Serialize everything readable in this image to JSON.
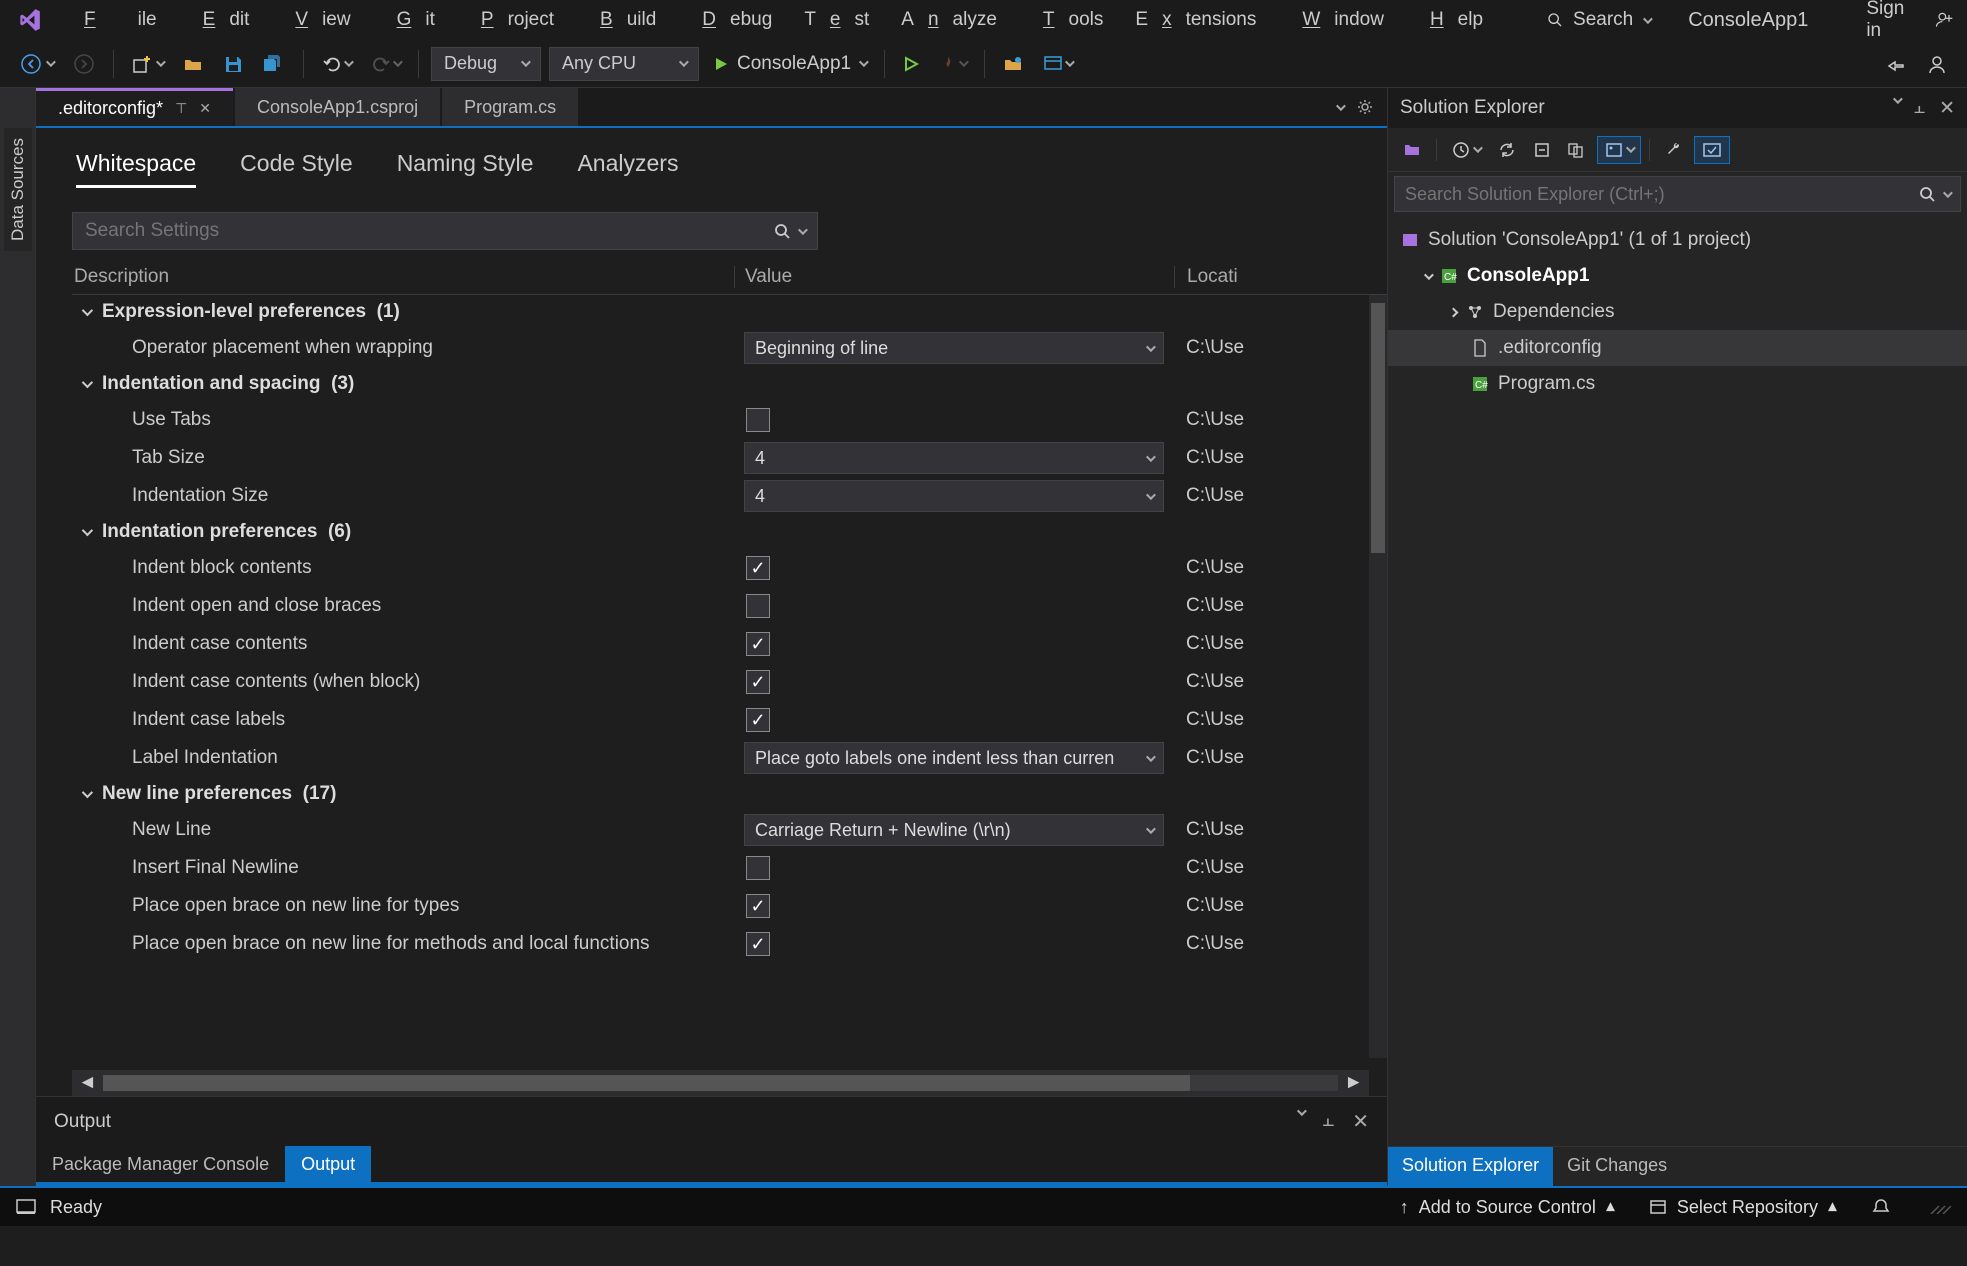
{
  "menu": {
    "file": "File",
    "edit": "Edit",
    "view": "View",
    "git": "Git",
    "project": "Project",
    "build": "Build",
    "debug": "Debug",
    "test": "Test",
    "analyze": "Analyze",
    "tools": "Tools",
    "extensions": "Extensions",
    "window": "Window",
    "help": "Help"
  },
  "titlebar": {
    "search": "Search",
    "app_title": "ConsoleApp1",
    "signin": "Sign in"
  },
  "toolbar": {
    "config": "Debug",
    "platform": "Any CPU",
    "start_target": "ConsoleApp1"
  },
  "left_rail": "Data Sources",
  "tabs": {
    "t1": ".editorconfig*",
    "t2": "ConsoleApp1.csproj",
    "t3": "Program.cs"
  },
  "ec": {
    "tabs": {
      "whitespace": "Whitespace",
      "codestyle": "Code Style",
      "naming": "Naming Style",
      "analyzers": "Analyzers"
    },
    "search_placeholder": "Search Settings",
    "cols": {
      "desc": "Description",
      "val": "Value",
      "loc": "Locati"
    },
    "loc_trunc": "C:\\Use",
    "groups": {
      "g1": {
        "title": "Expression-level preferences",
        "count": "(1)",
        "rows": [
          {
            "d": "Operator placement when wrapping",
            "v": {
              "type": "drop",
              "text": "Beginning of line"
            }
          }
        ]
      },
      "g2": {
        "title": "Indentation and spacing",
        "count": "(3)",
        "rows": [
          {
            "d": "Use Tabs",
            "v": {
              "type": "chk",
              "checked": false
            }
          },
          {
            "d": "Tab Size",
            "v": {
              "type": "drop",
              "text": "4"
            }
          },
          {
            "d": "Indentation Size",
            "v": {
              "type": "drop",
              "text": "4"
            }
          }
        ]
      },
      "g3": {
        "title": "Indentation preferences",
        "count": "(6)",
        "rows": [
          {
            "d": "Indent block contents",
            "v": {
              "type": "chk",
              "checked": true
            }
          },
          {
            "d": "Indent open and close braces",
            "v": {
              "type": "chk",
              "checked": false
            }
          },
          {
            "d": "Indent case contents",
            "v": {
              "type": "chk",
              "checked": true
            }
          },
          {
            "d": "Indent case contents (when block)",
            "v": {
              "type": "chk",
              "checked": true
            }
          },
          {
            "d": "Indent case labels",
            "v": {
              "type": "chk",
              "checked": true
            }
          },
          {
            "d": "Label Indentation",
            "v": {
              "type": "drop",
              "text": "Place goto labels one indent less than curren"
            }
          }
        ]
      },
      "g4": {
        "title": "New line preferences",
        "count": "(17)",
        "rows": [
          {
            "d": "New Line",
            "v": {
              "type": "drop",
              "text": "Carriage Return + Newline (\\r\\n)"
            }
          },
          {
            "d": "Insert Final Newline",
            "v": {
              "type": "chk",
              "checked": false
            }
          },
          {
            "d": "Place open brace on new line for types",
            "v": {
              "type": "chk",
              "checked": true
            }
          },
          {
            "d": "Place open brace on new line for methods and local functions",
            "v": {
              "type": "chk",
              "checked": true
            }
          }
        ]
      }
    }
  },
  "output_title": "Output",
  "bottom_tabs": {
    "pmc": "Package Manager Console",
    "output": "Output"
  },
  "solution": {
    "title": "Solution Explorer",
    "search_placeholder": "Search Solution Explorer (Ctrl+;)",
    "root": "Solution 'ConsoleApp1' (1 of 1 project)",
    "project": "ConsoleApp1",
    "dependencies": "Dependencies",
    "editorconfig": ".editorconfig",
    "program": "Program.cs",
    "bottom_tabs": {
      "se": "Solution Explorer",
      "git": "Git Changes"
    }
  },
  "status": {
    "ready": "Ready",
    "add_src": "Add to Source Control",
    "select_repo": "Select Repository"
  }
}
